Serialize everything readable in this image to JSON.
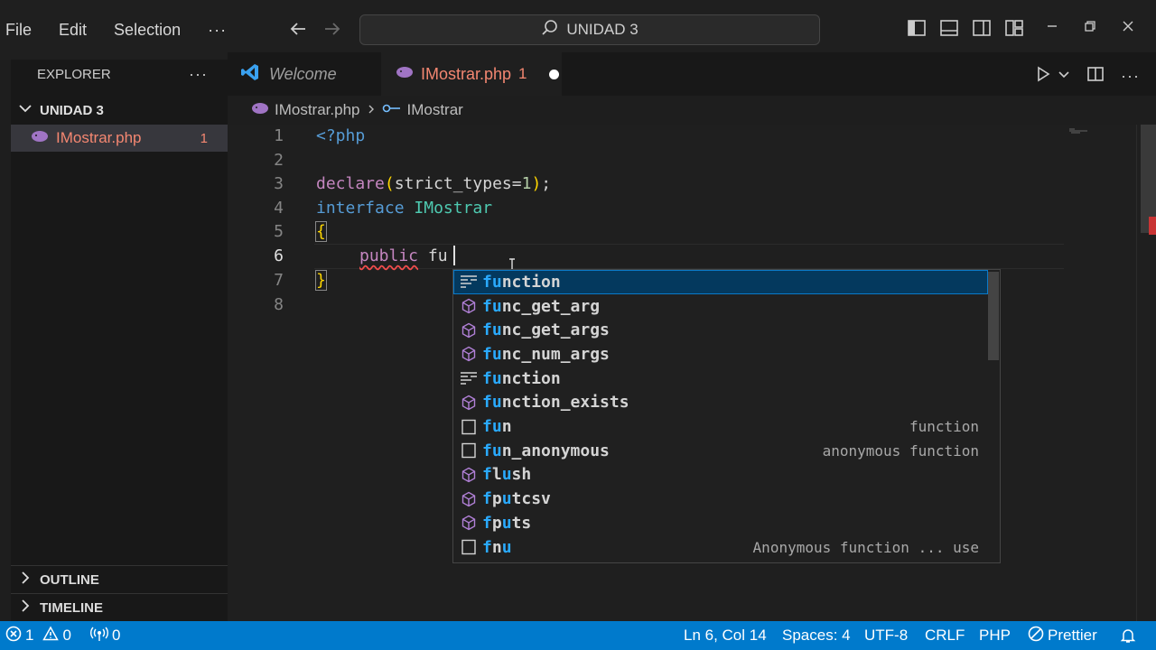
{
  "menu": {
    "file": "File",
    "edit": "Edit",
    "selection": "Selection",
    "more": "···"
  },
  "command_center": {
    "text": "UNIDAD 3"
  },
  "sidebar": {
    "title": "EXPLORER",
    "more": "···",
    "folder": "UNIDAD 3",
    "file": {
      "name": "IMostrar.php",
      "problems": "1"
    },
    "outline": "OUTLINE",
    "timeline": "TIMELINE"
  },
  "tabs": {
    "welcome": "Welcome",
    "active": {
      "name": "IMostrar.php",
      "problems": "1"
    }
  },
  "breadcrumb": {
    "file": "IMostrar.php",
    "symbol": "IMostrar"
  },
  "editor": {
    "lines": [
      "1",
      "2",
      "3",
      "4",
      "5",
      "6",
      "7",
      "8"
    ],
    "code": {
      "l1": "<?php",
      "l3_fn": "declare",
      "l3_open": "(",
      "l3_arg": "strict_types=",
      "l3_num": "1",
      "l3_close": ")",
      "l3_end": ";",
      "l4_kw": "interface",
      "l4_type": "IMostrar",
      "l5": "{",
      "l6_kw": "public",
      "l6_text": "fu",
      "l7": "}"
    }
  },
  "suggestions": [
    {
      "match": "fu",
      "rest": "nction",
      "detail": "",
      "icon": "snippet-icon",
      "selected": true
    },
    {
      "match": "fu",
      "rest": "nc_get_arg",
      "detail": "",
      "icon": "method-cube-icon"
    },
    {
      "match": "fu",
      "rest": "nc_get_args",
      "detail": "",
      "icon": "method-cube-icon"
    },
    {
      "match": "fu",
      "rest": "nc_num_args",
      "detail": "",
      "icon": "method-cube-icon"
    },
    {
      "match": "fu",
      "rest": "nction",
      "detail": "",
      "icon": "snippet-icon"
    },
    {
      "match": "fu",
      "rest": "nction_exists",
      "detail": "",
      "icon": "method-cube-icon"
    },
    {
      "match": "fu",
      "rest": "n",
      "detail": "function",
      "icon": "square-snippet-icon"
    },
    {
      "match": "fu",
      "rest": "n_anonymous",
      "detail": "anonymous function",
      "icon": "square-snippet-icon"
    },
    {
      "match": "f",
      "rest": "lush",
      "detail": "",
      "icon": "method-cube-icon",
      "pre": "",
      "mid": "u",
      "post": "sh",
      "split": true,
      "a": "fl",
      "b": "u",
      "c": "sh"
    },
    {
      "match": "f",
      "rest": "putcsv",
      "detail": "",
      "icon": "method-cube-icon",
      "split": true,
      "a": "fp",
      "b": "u",
      "c": "tcsv"
    },
    {
      "match": "f",
      "rest": "puts",
      "detail": "",
      "icon": "method-cube-icon",
      "split": true,
      "a": "fp",
      "b": "u",
      "c": "ts"
    },
    {
      "match": "f",
      "rest": "nu",
      "detail": "Anonymous function ... use",
      "icon": "square-snippet-icon",
      "split": true,
      "a": "fn",
      "b": "u",
      "c": ""
    }
  ],
  "status": {
    "errors": "1",
    "warnings": "0",
    "ports": "0",
    "position": "Ln 6, Col 14",
    "spaces": "Spaces: 4",
    "encoding": "UTF-8",
    "eol": "CRLF",
    "language": "PHP",
    "prettier": "Prettier"
  },
  "colors": {
    "accent": "#007acc",
    "error": "#f48771",
    "selection": "#04395e"
  }
}
